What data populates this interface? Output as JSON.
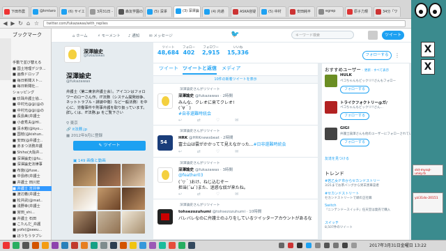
{
  "browser": {
    "tabs": [
      {
        "label": "下田市農",
        "color": "#e33"
      },
      {
        "label": "@kmtaro",
        "color": "#1da1f2"
      },
      {
        "label": "(6) サイエ",
        "color": "#1da1f2"
      },
      {
        "label": "3月31日 -",
        "color": "#999"
      },
      {
        "label": "森友学園の",
        "color": "#555"
      },
      {
        "label": "(5) 深澤",
        "color": "#1da1f2"
      },
      {
        "label": "(3) 深澤論",
        "color": "#1da1f2"
      },
      {
        "label": "(4) 内通",
        "color": "#1da1f2"
      },
      {
        "label": "ASKA容疑",
        "color": "#c33"
      },
      {
        "label": "(5) 中村",
        "color": "#1da1f2"
      },
      {
        "label": "安田純平",
        "color": "#c33"
      },
      {
        "label": "egrep",
        "color": "#888"
      },
      {
        "label": "原子力規",
        "color": "#d33"
      },
      {
        "label": "34分「ワ",
        "color": "#c33"
      }
    ],
    "active_tab": "(3) 深澤論",
    "url": "twitter.com/fukazawas/with_replies"
  },
  "sidebar": {
    "title": "ブックマーク",
    "items": [
      "手動で並び替える",
      "■ 国土地理デジタ...",
      "■ 画像ドロップ",
      "■ 毎日新聞スト...",
      "■ 毎日新聞社...",
      "ショッピング",
      "■ 玖珠弁護士協...",
      "■ 中村光@@(@の",
      "■ 中村光@@(@の",
      "■ 長島美(弁護士",
      "■ 小倉秀夫@HI..",
      "■ 清水勉(@kyo...",
      "■ 国枝(@kishun..",
      "■ 安田(@弁護士..",
      "■ 赤まつ法務弁護",
      "■ Shiho(大阪弁...",
      "■ 深澤論史(@fu..",
      "■ 深澤論史法律事",
      "■ 布施(@fuse..",
      "■ 中島修(弁護士",
      "■ 弁護士 田川宏",
      "■ 弁護士 吉井伸",
      "■ 渡辺義(弁護士",
      "■ 松井武(@mat..",
      "■ 浅野幸(弁護士",
      "■ 宮田_shi...",
      "■ 弁護士 石田",
      "■ こたんだ_弁護",
      "■ yofx(@seeu...",
      "■ ほうちうラブレ"
    ],
    "selected_index": 21
  },
  "twitter_nav": {
    "home": "ホーム",
    "moments": "モーメント",
    "notifications": "通知",
    "messages": "メッセージ",
    "search_placeholder": "キーワード検索",
    "tweet_button": "ツイート"
  },
  "profile": {
    "name": "深澤諭史",
    "handle": "@fukazawas",
    "bio": "弁護士（第二東京弁護士会）。アイコンはフォロワーのローさん作。IT法務（システム開発紛争、ネットトラブル・誹謗中傷）など一般法務）を中心に、労働事件や刑事弁護を取り扱っています。詳しくは、IT法務.jp をご覧下さい",
    "location": "東京",
    "website": "it法務.jp",
    "joined": "2012年9月に登録",
    "tweet_button": "ツイート",
    "media_header": "149 画像と動画"
  },
  "stats": [
    {
      "label": "ツイート",
      "value": "48,684"
    },
    {
      "label": "フォロー",
      "value": "402"
    },
    {
      "label": "フォロワー",
      "value": "2,915"
    },
    {
      "label": "いいね",
      "value": "15,336"
    }
  ],
  "follow_button": "フォローする",
  "timeline": {
    "tabs": [
      "ツイート",
      "ツイートと返信",
      "メディア"
    ],
    "active_tab": "ツイートと返信",
    "new_tweets": "10件の新着ツイートを表示",
    "tweets": [
      {
        "retweet": "深澤諭史さんがリツイート",
        "name": "深澤論史",
        "handle": "@fukazawas · 2時間",
        "line1": "みんな、クレオに来てクレオ!",
        "line2": "(´∀｀)",
        "line3": "#自非還難時統会"
      },
      {
        "retweet": "深澤論史さんがリツイート",
        "name": "HRK",
        "handle": "@HRKnewsbeat · 2時間",
        "line1": "富士山は雲がかかってて見えなかった...",
        "line1_link": "#日非還難時統会"
      },
      {
        "retweet": "深澤論史さんがリツイート",
        "name": "深澤論史",
        "handle": "@fukazawas · 3時間",
        "line1": "@feather03",
        "line2": "(´▽｀)おけ、ねじ込むぞー",
        "line3": "担当(´ω`)また、迷惑な奴が来たね。"
      },
      {
        "retweet": "深澤論史さんがリツイート",
        "name": "tohsezozuhumi",
        "handle": "@tohsezozuhumi · 10時間",
        "line1": "バレバレなのに弁護士のふりをしているツイッターアカウントがあるな"
      }
    ]
  },
  "right": {
    "header": "おすすめユーザー",
    "header_links": "· 更新 · すべて表示",
    "suggestions": [
      {
        "name": "HULK",
        "sub": "ペコちゃんもビックリ!!さんもフォロー",
        "btn": "フォローする"
      },
      {
        "name": "トライクフォクトリー@ガ/",
        "sub": "ペコちゃんもビックリ!!さん...",
        "btn": "フォローする"
      },
      {
        "name": "GIGI",
        "sub": "弁護士諭澤さんも他のユーザーにフォローされています",
        "btn": "フォローする"
      }
    ],
    "more": "友達を見つける",
    "trend_header": "トレンド",
    "trends": [
      {
        "tag": "#若乙女Ｐ市からセカンドストリー",
        "sub": "3/21までお茶バングから男羊黒車菜者"
      },
      {
        "tag": "#セカンドストリート",
        "sub": "セカンドストリートで頭の正社職"
      },
      {
        "tag": "Switch",
        "sub": "『ニンテンドースイッチ』任天堂は発売で購入"
      },
      {
        "tag": "スイッチ",
        "sub": "8,507件のツイート"
      }
    ]
  },
  "taskbar": {
    "clock": "2017年3月31日金曜日 13:22"
  },
  "desktop": {
    "xterm1": "std-mysql-uniq.rb",
    "xterm2": "yzi31do-20151"
  }
}
